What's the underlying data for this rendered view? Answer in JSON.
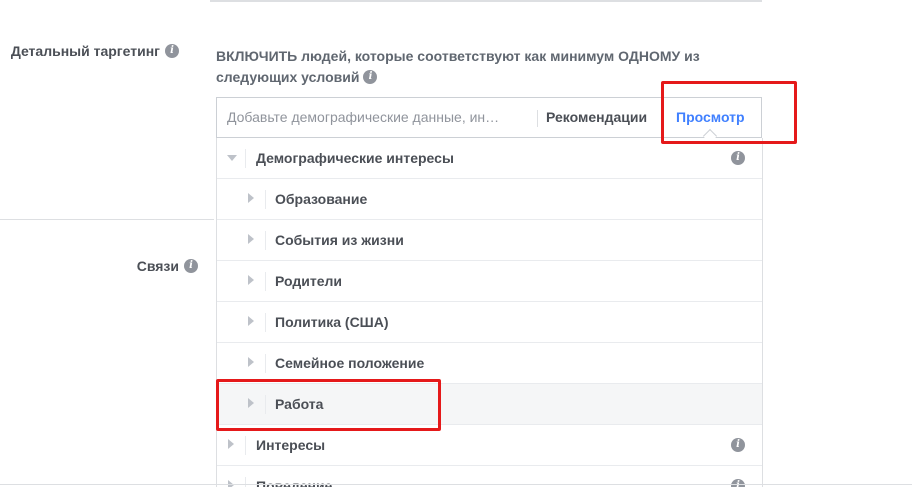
{
  "left_labels": {
    "detailed_targeting": "Детальный таргетинг",
    "connections": "Связи"
  },
  "include_text": "ВКЛЮЧИТЬ людей, которые соответствуют как минимум ОДНОМУ из следующих условий",
  "search": {
    "placeholder": "Добавьте демографические данные, ин…",
    "recommend_label": "Рекомендации",
    "browse_label": "Просмотр"
  },
  "tree": {
    "demographics": "Демографические интересы",
    "children": [
      "Образование",
      "События из жизни",
      "Родители",
      "Политика (США)",
      "Семейное положение",
      "Работа"
    ],
    "interests": "Интересы",
    "behaviors": "Поведение"
  },
  "colors": {
    "accent": "#4080ff",
    "highlight": "#e5191a"
  },
  "icons": {
    "info": "i"
  }
}
